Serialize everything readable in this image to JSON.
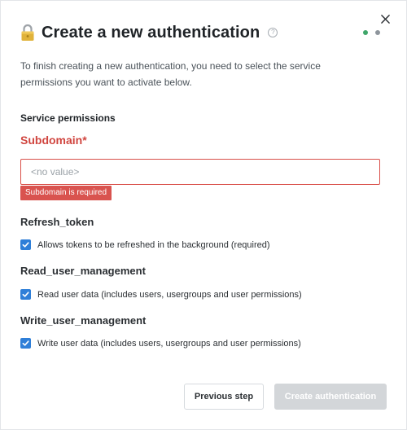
{
  "dialog": {
    "title": "Create a new authentication",
    "help_glyph": "?",
    "close_glyph": "✕",
    "intro": "To finish creating a new authentication, you need to select the service permissions you want to activate below.",
    "section_title": "Service permissions",
    "steps": {
      "total": 2,
      "current": 1
    }
  },
  "subdomain": {
    "label": "Subdomain*",
    "value": "",
    "placeholder": "<no value>",
    "error": "Subdomain is required"
  },
  "permissions": [
    {
      "title": "Refresh_token",
      "label": "Allows tokens to be refreshed in the background (required)",
      "checked": true
    },
    {
      "title": "Read_user_management",
      "label": "Read user data (includes users, usergroups and user permissions)",
      "checked": true
    },
    {
      "title": "Write_user_management",
      "label": "Write user data (includes users, usergroups and user permissions)",
      "checked": true
    }
  ],
  "buttons": {
    "previous": "Previous step",
    "create": "Create authentication"
  },
  "colors": {
    "error": "#d9534f",
    "checkbox": "#2f7fd8",
    "step_active": "#3fa66a",
    "step_inactive": "#8e959c",
    "disabled_button": "#d3d6d9"
  }
}
